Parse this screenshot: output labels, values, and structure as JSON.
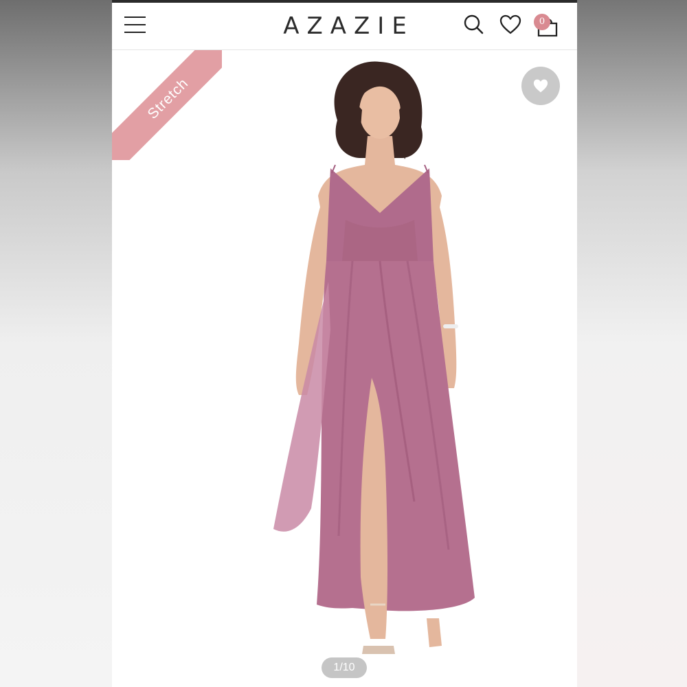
{
  "header": {
    "logo": "AZAZIE",
    "icons": [
      "menu-icon",
      "search-icon",
      "heart-icon",
      "shopping-bag-icon"
    ],
    "cart_count": "0"
  },
  "product": {
    "badge": "Stretch",
    "image_alt": "Model wearing a mauve long chiffon dress with spaghetti straps and a front slit",
    "pager": "1/10"
  },
  "colors": {
    "brand_pink": "#e29fa4",
    "dress_mauve": "#b06b8c",
    "fav_button_bg": "#c9c9c9"
  }
}
